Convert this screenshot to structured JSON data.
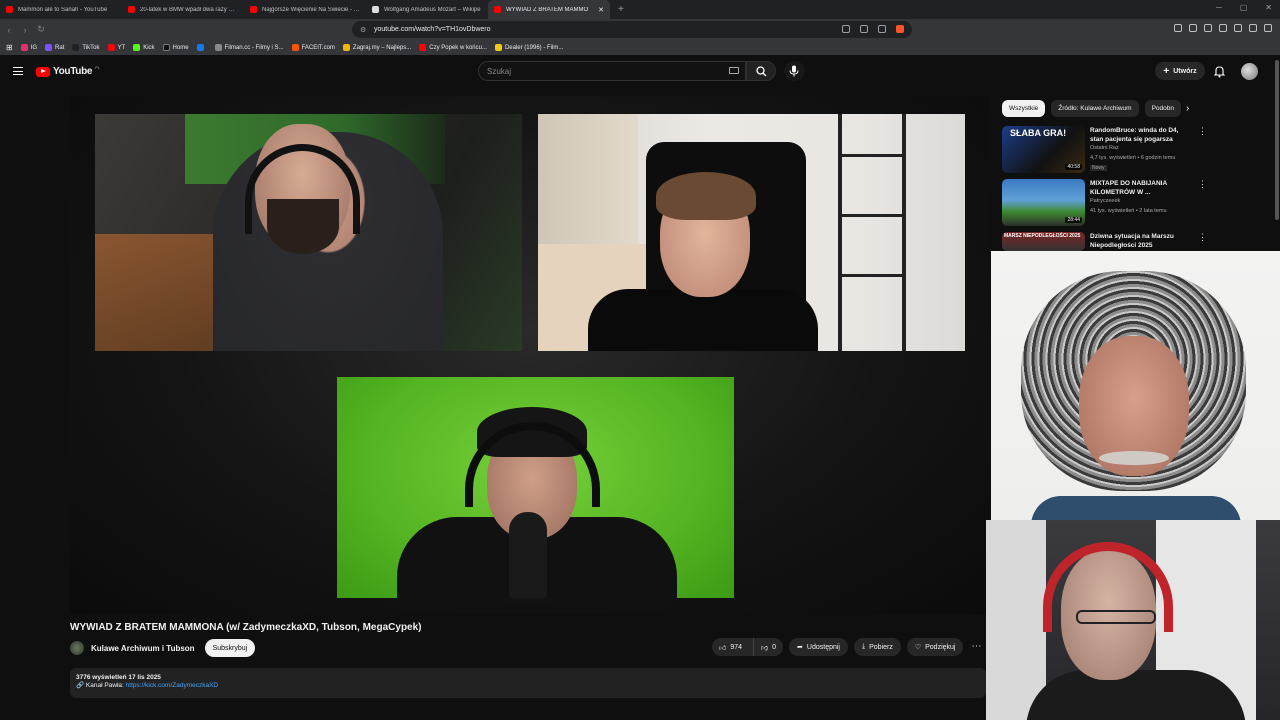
{
  "browser": {
    "tabs": [
      {
        "label": "Mammon ale to Sanah - YouTube",
        "fav": "#ff0000",
        "active": false
      },
      {
        "label": "20-latek w BMW wpadł dwa razy w jed",
        "fav": "#ff0000",
        "active": false
      },
      {
        "label": "Najgorsze Więcienie Na Świecie - Yo",
        "fav": "#ff0000",
        "active": false
      },
      {
        "label": "Wolfgang Amadeus Mozart – Wikipe",
        "fav": "#dddddd",
        "active": false
      },
      {
        "label": "WYWIAD Z BRATEM MAMMO",
        "fav": "#ff0000",
        "active": true
      }
    ],
    "new_tab": "+",
    "url": "youtube.com/watch?v=TH1ovDbwero",
    "bookmarks": [
      {
        "label": "IG",
        "color": "#e1306c"
      },
      {
        "label": "Rat",
        "color": "#7b52ff"
      },
      {
        "label": "TikTok",
        "color": "#222222"
      },
      {
        "label": "YT",
        "color": "#ff0000"
      },
      {
        "label": "Kick",
        "color": "#53fc18"
      },
      {
        "label": "Home",
        "color": "#111111"
      },
      {
        "label": "",
        "color": "#1877f2"
      },
      {
        "label": "Filman.cc - Filmy i S...",
        "color": "#888888"
      },
      {
        "label": "FACEIT.com",
        "color": "#ff5500"
      },
      {
        "label": "Zagraj.my – Najleps...",
        "color": "#f5b400"
      },
      {
        "label": "Czy Popek w końcu...",
        "color": "#ff0000"
      },
      {
        "label": "Dealer (1996) - Film...",
        "color": "#f5c518"
      }
    ]
  },
  "youtube": {
    "logo_text": "YouTube",
    "region": "PL",
    "search_placeholder": "Szukaj",
    "create_label": "Utwórz"
  },
  "video": {
    "title": "WYWIAD Z BRATEM MAMMONA (w/ ZadymeczkaXD, Tubson, MegaCypek)",
    "channel": "Kulawe Archiwum i Tubson",
    "subscribe_label": "Subskrybuj",
    "likes": "974",
    "dislikes": "0",
    "share_label": "Udostępnij",
    "download_label": "Pobierz",
    "thanks_label": "Podziękuj",
    "views_date": "3776 wyświetleń  17 lis 2025",
    "desc_prefix": "🔗 Kanał Pawła: ",
    "desc_link": "https://kick.com/ZadymeczkaXD"
  },
  "sidebar": {
    "chips": [
      "Wszystkie",
      "Źródło: Kulawe Archiwum",
      "Podobn"
    ],
    "recs": [
      {
        "title": "RandomBruce: winda do D4, stan pacjenta się pogarsza",
        "channel": "Ostatni Raz",
        "meta": "4,7 tys. wyświetleń • 6 godzin temu",
        "badge": "Nowy",
        "duration": "40:58",
        "thumb_text": "SŁABA GRA!"
      },
      {
        "title": "MIXTAPE DO NABIJANIA KILOMETRÓW W ...",
        "channel": "Patryczeeek",
        "meta": "41 tys. wyświetleń • 2 lata temu",
        "badge": "",
        "duration": "28:44",
        "thumb_text": ""
      },
      {
        "title": "Dziwna sytuacja na Marszu Niepodległości 2025",
        "channel": "",
        "meta": "",
        "badge": "",
        "duration": "",
        "thumb_text": "MARSZ NIEPODLEGŁOŚCI 2025"
      }
    ]
  }
}
